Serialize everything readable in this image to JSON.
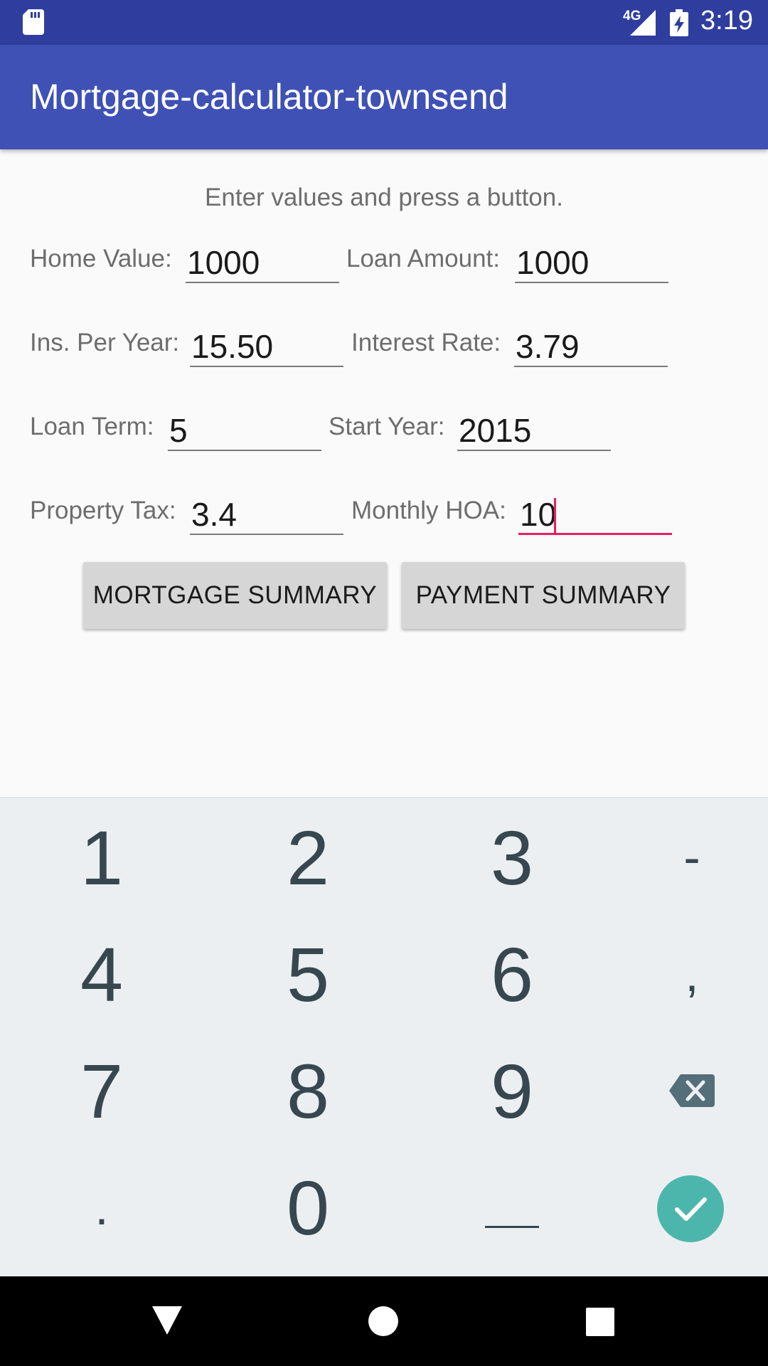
{
  "status_bar": {
    "time": "3:19",
    "network": "4G",
    "icons": [
      "sd-card-icon",
      "signal-icon",
      "battery-charging-icon"
    ]
  },
  "app_bar": {
    "title": "Mortgage-calculator-townsend",
    "color": "#3f51b5"
  },
  "form": {
    "instructions": "Enter values and press a button.",
    "home_value": {
      "label": "Home Value:",
      "value": "1000"
    },
    "loan_amount": {
      "label": "Loan Amount:",
      "value": "1000"
    },
    "ins_per_year": {
      "label": "Ins. Per Year:",
      "value": "15.50"
    },
    "interest_rate": {
      "label": "Interest Rate:",
      "value": "3.79"
    },
    "loan_term": {
      "label": "Loan Term:",
      "value": "5"
    },
    "start_year": {
      "label": "Start Year:",
      "value": "2015"
    },
    "property_tax": {
      "label": "Property Tax:",
      "value": "3.4"
    },
    "monthly_hoa": {
      "label": "Monthly HOA:",
      "value": "10"
    },
    "accent_color": "#e91e63"
  },
  "buttons": {
    "mortgage_summary": "MORTGAGE SUMMARY",
    "payment_summary": "PAYMENT SUMMARY"
  },
  "keyboard": {
    "rows": [
      [
        "1",
        "2",
        "3",
        "-"
      ],
      [
        "4",
        "5",
        "6",
        ","
      ],
      [
        "7",
        "8",
        "9",
        "backspace-icon"
      ],
      [
        ".",
        "0",
        "space-icon",
        "done-check-icon"
      ]
    ],
    "k1": "1",
    "k2": "2",
    "k3": "3",
    "kdash": "-",
    "k4": "4",
    "k5": "5",
    "k6": "6",
    "kcomma": ",",
    "k7": "7",
    "k8": "8",
    "k9": "9",
    "kdot": ".",
    "k0": "0"
  },
  "nav_bar": {
    "icons": [
      "back-icon",
      "home-icon",
      "recents-icon"
    ]
  }
}
